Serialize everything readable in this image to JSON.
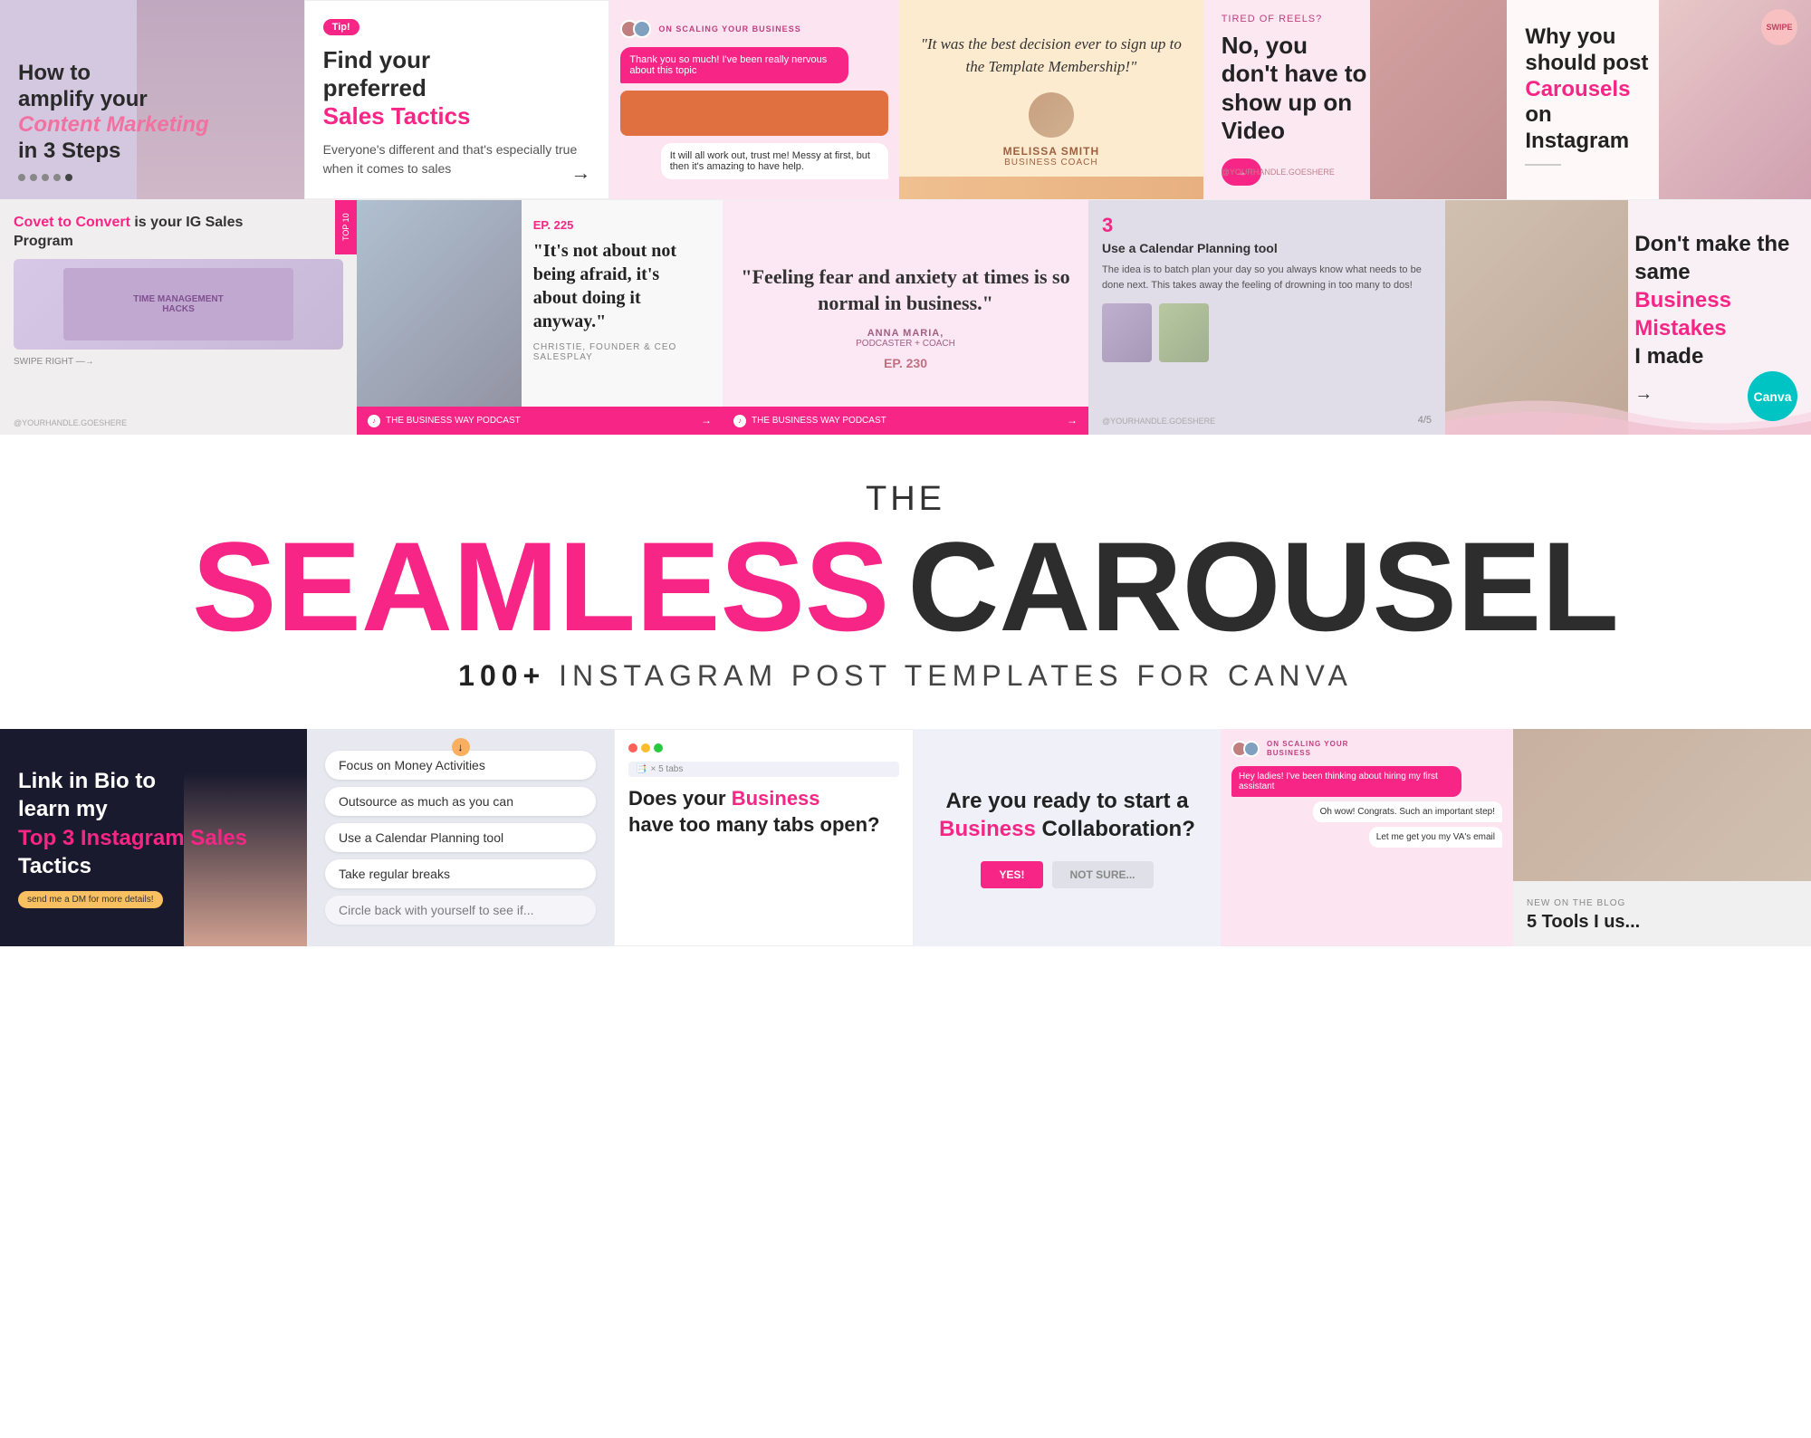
{
  "top_row": {
    "card1": {
      "title_line1": "How to",
      "title_line2": "amplify your",
      "title_highlight": "Content Marketing",
      "title_line3": "in 3 Steps",
      "bg_color": "#d4c8e0"
    },
    "card2": {
      "tip_badge": "Tip!",
      "heading_line1": "Find your",
      "heading_line2": "preferred",
      "heading_highlight": "Sales Tactics",
      "body_text": "Everyone's different and that's especially true when it comes to sales",
      "bg_color": "#ffffff"
    },
    "card3": {
      "label": "ON SCALING YOUR BUSINESS",
      "bubble1": "Thank you so much! I've been really nervous about this topic",
      "bubble2": "It will all work out, trust me! Messy at first, but then it's amazing to have help.",
      "bg_color": "#fce4f0"
    },
    "card4": {
      "quote": "\"It was the best decision ever to sign up to the Template Membership!\"",
      "person_name": "MELISSA SMITH",
      "person_title": "BUSINESS COACH",
      "bg_color": "#fdebd0"
    },
    "card5": {
      "label": "TIRED OF REELS?",
      "heading": "No, you don't have to show up on Video",
      "bg_color": "#fce8f0",
      "handle": "@YOURHANDLE.GOESHERE"
    },
    "card6": {
      "heading_line1": "Why you",
      "heading_line2": "should post",
      "heading_highlight": "Carousels",
      "heading_line3": "on Instagram",
      "bg_color": "#fef8f8"
    }
  },
  "mid_row": {
    "card1": {
      "tag": "TOP 10",
      "heading_part1": "Covet to Convert",
      "heading_part2": " is your IG Sales Program",
      "swipe": "SWIPE RIGHT →",
      "handle": "@YOURHANDLE.GOESHERE"
    },
    "card2": {
      "episode": "EP. 225",
      "quote": "\"It's not about not being afraid, it's about doing it anyway.\"",
      "attribution": "CHRISTIE, FOUNDER & CEO\nSALESPLAY",
      "footer_text": "THE BUSINESS WAY PODCAST",
      "bg_color": "#f8f8f8"
    },
    "card3": {
      "quote": "\"Feeling fear and anxiety at times is so normal in business.\"",
      "person_name": "ANNA MARIA,",
      "person_title": "PODCASTER + COACH",
      "episode": "EP. 230",
      "footer_text": "THE BUSINESS WAY PODCAST",
      "bg_color": "#fce8f4"
    },
    "card4": {
      "number": "3",
      "tip_title": "Use a Calendar Planning tool",
      "tip_body": "The idea is to batch plan your day so you always know what needs to be done next. This takes away the feeling of drowning in too many to dos!",
      "page_num": "4/5",
      "handle": "@YOURHANDLE.GOESHERE",
      "bg_color": "#e0dce8"
    },
    "card5": {
      "heading_part1": "Don't make the same",
      "heading_highlight": "Business Mistakes",
      "heading_part2": " I made",
      "bg_color": "#f8f0f4"
    }
  },
  "title_section": {
    "the": "THE",
    "seamless": "SEAMLESS",
    "carousel": "CAROUSEL",
    "subtitle_bold": "100+",
    "subtitle_rest": " INSTAGRAM POST TEMPLATES FOR CANVA"
  },
  "bottom_row": {
    "card1": {
      "line1": "Link in Bio to",
      "line2": "learn my",
      "highlight": "Top 3 Instagram Sales",
      "line3": "Tactics",
      "badge": "send me a DM for more details!",
      "bg_color": "#1a1a2e"
    },
    "card2": {
      "items": [
        "Focus on Money Activities",
        "Outsource as much as you can",
        "Use a Calendar Planning tool",
        "Take regular breaks",
        "Circle back with yourself to see if..."
      ],
      "bg_color": "#e8e8f0"
    },
    "card3": {
      "heading_part1": "Does your",
      "heading_highlight": "Business",
      "heading_part2": "have too many tabs open?",
      "bg_color": "#ffffff"
    },
    "card4": {
      "question_part1": "Are you ready to start a",
      "question_highlight": "Business",
      "question_part2": "Collaboration?",
      "btn_yes": "YES!",
      "btn_no": "NOT SURE...",
      "bg_color": "#f0f0f8"
    },
    "card5": {
      "label": "ON SCALING YOUR BUSINESS",
      "bubble1": "Hey ladies! I've been thinking about hiring my first assistant",
      "bubble2": "Oh wow! Congrats. Such an important step!",
      "bubble3": "Let me get you my VA's email",
      "bg_color": "#fce4f0"
    },
    "card6": {
      "new_label": "NEW ON THE BLOG",
      "heading": "5 Tools I us...",
      "bg_color": "#f0f0f0"
    }
  }
}
